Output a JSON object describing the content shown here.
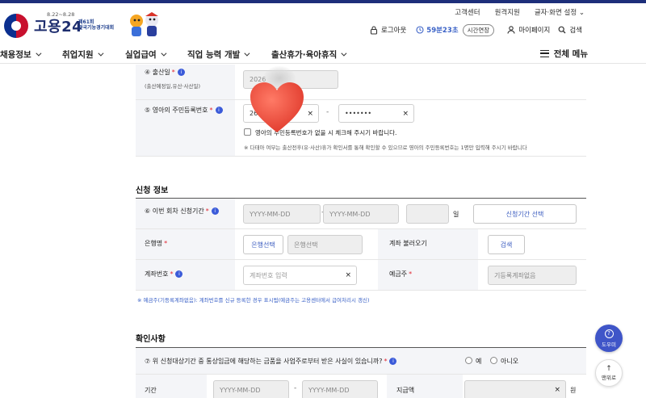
{
  "header": {
    "utility_links": [
      "고객센터",
      "원격지원",
      "글자·화면 설정"
    ],
    "logo_text": "고용24",
    "event_dates": "8.22~8.28",
    "event_name_line1": "제61회",
    "event_name_line2": "전국기능경기대회",
    "logout": "로그아웃",
    "timer": "59분23초",
    "extend": "시간연장",
    "mypage": "마이페이지",
    "search": "검색"
  },
  "gnb": {
    "items": [
      "채용정보",
      "취업지원",
      "실업급여",
      "직업 능력 개발",
      "출산휴가·육아휴직"
    ],
    "full_menu": "전체 메뉴"
  },
  "child": {
    "birth_label": "④ 출산일",
    "birth_sub": "(출산예정일,유산·사산일)",
    "birth_value": "2026",
    "rrn_label": "⑤ 영아의 주민등록번호",
    "rrn_front": "26",
    "rrn_back": "•••••••",
    "rrn_check": "영아의 주민등록번호가 없을 시 체크해 주시기 바랍니다.",
    "rrn_note": "※ 다태아 여부는 출산전후(유·사산)휴가 확인서를 통해 확인할 수 있으므로 영아의 주민등록번호는 1명만 입력해 주시기 바랍니다"
  },
  "apply": {
    "section_title": "신청 정보",
    "period_label": "⑥ 이번 회차 신청기간",
    "date_placeholder": "YYYY-MM-DD",
    "days_unit": "일",
    "period_select": "신청기간 선택",
    "bank_label": "은행명",
    "bank_select": "은행선택",
    "bank_placeholder": "은행선택",
    "account_fetch_label": "계좌 불러오기",
    "account_fetch_button": "검색",
    "account_label": "계좌번호",
    "account_placeholder": "계좌번호 입력",
    "holder_label": "예금주",
    "holder_placeholder": "기등록계좌없음",
    "note": "※ 예금주(기등록계좌없음): 계좌번호를 신규 등록한 경우 표시됨(예금주는 고용센터에서 급여처리시 갱신)"
  },
  "confirm": {
    "section_title": "확인사항",
    "q7": "⑦ 위 신청대상기간 중 통상임금에 해당하는 금품을 사업주로부터 받은 사실이 있습니까?",
    "yes": "예",
    "no": "아니오",
    "period_label": "기간",
    "date_placeholder": "YYYY-MM-DD",
    "amount_label": "지급액",
    "won": "원"
  },
  "floating": {
    "help": "도우미",
    "top": "맨위로"
  }
}
